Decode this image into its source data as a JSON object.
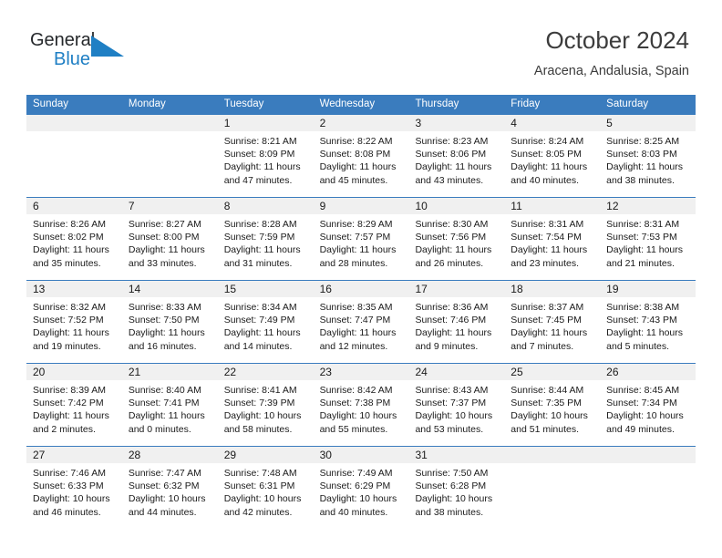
{
  "brand": {
    "name_part1": "General",
    "name_part2": "Blue",
    "accent_color": "#1f7fc4",
    "logo_icon": "triangle-logo-icon"
  },
  "header": {
    "title": "October 2024",
    "location": "Aracena, Andalusia, Spain"
  },
  "calendar": {
    "header_color": "#3a7cbe",
    "weekdays": [
      "Sunday",
      "Monday",
      "Tuesday",
      "Wednesday",
      "Thursday",
      "Friday",
      "Saturday"
    ],
    "weeks": [
      [
        {
          "day": "",
          "sunrise": "",
          "sunset": "",
          "daylight": ""
        },
        {
          "day": "",
          "sunrise": "",
          "sunset": "",
          "daylight": ""
        },
        {
          "day": "1",
          "sunrise": "Sunrise: 8:21 AM",
          "sunset": "Sunset: 8:09 PM",
          "daylight": "Daylight: 11 hours and 47 minutes."
        },
        {
          "day": "2",
          "sunrise": "Sunrise: 8:22 AM",
          "sunset": "Sunset: 8:08 PM",
          "daylight": "Daylight: 11 hours and 45 minutes."
        },
        {
          "day": "3",
          "sunrise": "Sunrise: 8:23 AM",
          "sunset": "Sunset: 8:06 PM",
          "daylight": "Daylight: 11 hours and 43 minutes."
        },
        {
          "day": "4",
          "sunrise": "Sunrise: 8:24 AM",
          "sunset": "Sunset: 8:05 PM",
          "daylight": "Daylight: 11 hours and 40 minutes."
        },
        {
          "day": "5",
          "sunrise": "Sunrise: 8:25 AM",
          "sunset": "Sunset: 8:03 PM",
          "daylight": "Daylight: 11 hours and 38 minutes."
        }
      ],
      [
        {
          "day": "6",
          "sunrise": "Sunrise: 8:26 AM",
          "sunset": "Sunset: 8:02 PM",
          "daylight": "Daylight: 11 hours and 35 minutes."
        },
        {
          "day": "7",
          "sunrise": "Sunrise: 8:27 AM",
          "sunset": "Sunset: 8:00 PM",
          "daylight": "Daylight: 11 hours and 33 minutes."
        },
        {
          "day": "8",
          "sunrise": "Sunrise: 8:28 AM",
          "sunset": "Sunset: 7:59 PM",
          "daylight": "Daylight: 11 hours and 31 minutes."
        },
        {
          "day": "9",
          "sunrise": "Sunrise: 8:29 AM",
          "sunset": "Sunset: 7:57 PM",
          "daylight": "Daylight: 11 hours and 28 minutes."
        },
        {
          "day": "10",
          "sunrise": "Sunrise: 8:30 AM",
          "sunset": "Sunset: 7:56 PM",
          "daylight": "Daylight: 11 hours and 26 minutes."
        },
        {
          "day": "11",
          "sunrise": "Sunrise: 8:31 AM",
          "sunset": "Sunset: 7:54 PM",
          "daylight": "Daylight: 11 hours and 23 minutes."
        },
        {
          "day": "12",
          "sunrise": "Sunrise: 8:31 AM",
          "sunset": "Sunset: 7:53 PM",
          "daylight": "Daylight: 11 hours and 21 minutes."
        }
      ],
      [
        {
          "day": "13",
          "sunrise": "Sunrise: 8:32 AM",
          "sunset": "Sunset: 7:52 PM",
          "daylight": "Daylight: 11 hours and 19 minutes."
        },
        {
          "day": "14",
          "sunrise": "Sunrise: 8:33 AM",
          "sunset": "Sunset: 7:50 PM",
          "daylight": "Daylight: 11 hours and 16 minutes."
        },
        {
          "day": "15",
          "sunrise": "Sunrise: 8:34 AM",
          "sunset": "Sunset: 7:49 PM",
          "daylight": "Daylight: 11 hours and 14 minutes."
        },
        {
          "day": "16",
          "sunrise": "Sunrise: 8:35 AM",
          "sunset": "Sunset: 7:47 PM",
          "daylight": "Daylight: 11 hours and 12 minutes."
        },
        {
          "day": "17",
          "sunrise": "Sunrise: 8:36 AM",
          "sunset": "Sunset: 7:46 PM",
          "daylight": "Daylight: 11 hours and 9 minutes."
        },
        {
          "day": "18",
          "sunrise": "Sunrise: 8:37 AM",
          "sunset": "Sunset: 7:45 PM",
          "daylight": "Daylight: 11 hours and 7 minutes."
        },
        {
          "day": "19",
          "sunrise": "Sunrise: 8:38 AM",
          "sunset": "Sunset: 7:43 PM",
          "daylight": "Daylight: 11 hours and 5 minutes."
        }
      ],
      [
        {
          "day": "20",
          "sunrise": "Sunrise: 8:39 AM",
          "sunset": "Sunset: 7:42 PM",
          "daylight": "Daylight: 11 hours and 2 minutes."
        },
        {
          "day": "21",
          "sunrise": "Sunrise: 8:40 AM",
          "sunset": "Sunset: 7:41 PM",
          "daylight": "Daylight: 11 hours and 0 minutes."
        },
        {
          "day": "22",
          "sunrise": "Sunrise: 8:41 AM",
          "sunset": "Sunset: 7:39 PM",
          "daylight": "Daylight: 10 hours and 58 minutes."
        },
        {
          "day": "23",
          "sunrise": "Sunrise: 8:42 AM",
          "sunset": "Sunset: 7:38 PM",
          "daylight": "Daylight: 10 hours and 55 minutes."
        },
        {
          "day": "24",
          "sunrise": "Sunrise: 8:43 AM",
          "sunset": "Sunset: 7:37 PM",
          "daylight": "Daylight: 10 hours and 53 minutes."
        },
        {
          "day": "25",
          "sunrise": "Sunrise: 8:44 AM",
          "sunset": "Sunset: 7:35 PM",
          "daylight": "Daylight: 10 hours and 51 minutes."
        },
        {
          "day": "26",
          "sunrise": "Sunrise: 8:45 AM",
          "sunset": "Sunset: 7:34 PM",
          "daylight": "Daylight: 10 hours and 49 minutes."
        }
      ],
      [
        {
          "day": "27",
          "sunrise": "Sunrise: 7:46 AM",
          "sunset": "Sunset: 6:33 PM",
          "daylight": "Daylight: 10 hours and 46 minutes."
        },
        {
          "day": "28",
          "sunrise": "Sunrise: 7:47 AM",
          "sunset": "Sunset: 6:32 PM",
          "daylight": "Daylight: 10 hours and 44 minutes."
        },
        {
          "day": "29",
          "sunrise": "Sunrise: 7:48 AM",
          "sunset": "Sunset: 6:31 PM",
          "daylight": "Daylight: 10 hours and 42 minutes."
        },
        {
          "day": "30",
          "sunrise": "Sunrise: 7:49 AM",
          "sunset": "Sunset: 6:29 PM",
          "daylight": "Daylight: 10 hours and 40 minutes."
        },
        {
          "day": "31",
          "sunrise": "Sunrise: 7:50 AM",
          "sunset": "Sunset: 6:28 PM",
          "daylight": "Daylight: 10 hours and 38 minutes."
        },
        {
          "day": "",
          "sunrise": "",
          "sunset": "",
          "daylight": ""
        },
        {
          "day": "",
          "sunrise": "",
          "sunset": "",
          "daylight": ""
        }
      ]
    ]
  }
}
